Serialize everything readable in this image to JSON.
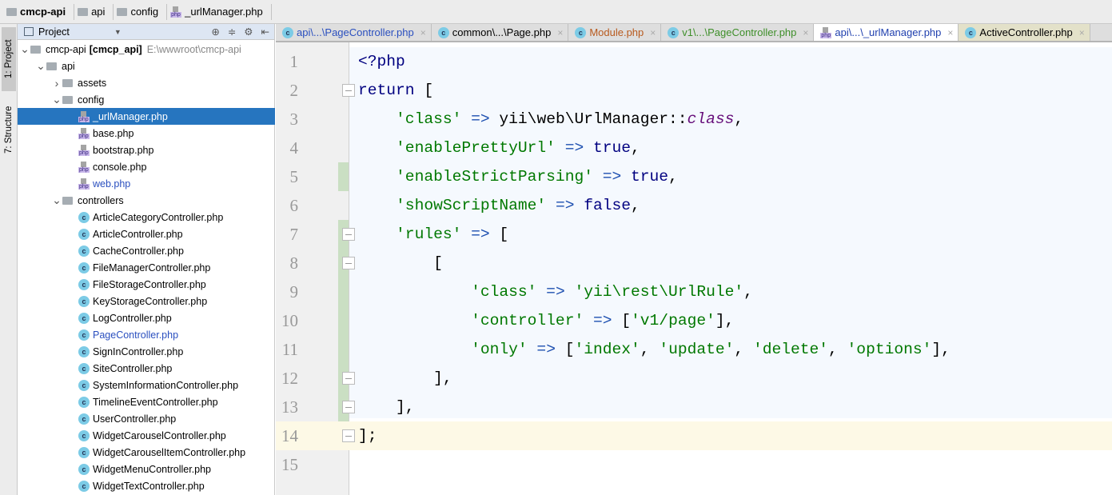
{
  "breadcrumb": [
    "cmcp-api",
    "api",
    "config",
    "_urlManager.php"
  ],
  "sidebar_tabs": [
    "1: Project",
    "7: Structure"
  ],
  "project": {
    "title": "Project",
    "tree": [
      {
        "label": "cmcp-api",
        "bold": "[cmcp_api]",
        "path": "E:\\wwwroot\\cmcp-api",
        "depth": 0,
        "kind": "folder",
        "exp": "v"
      },
      {
        "label": "api",
        "depth": 1,
        "kind": "folder",
        "exp": "v"
      },
      {
        "label": "assets",
        "depth": 2,
        "kind": "folder",
        "exp": ">"
      },
      {
        "label": "config",
        "depth": 2,
        "kind": "folder",
        "exp": "v"
      },
      {
        "label": "_urlManager.php",
        "depth": 3,
        "kind": "php",
        "selected": true
      },
      {
        "label": "base.php",
        "depth": 3,
        "kind": "php"
      },
      {
        "label": "bootstrap.php",
        "depth": 3,
        "kind": "php"
      },
      {
        "label": "console.php",
        "depth": 3,
        "kind": "php"
      },
      {
        "label": "web.php",
        "depth": 3,
        "kind": "php",
        "color": "#2a4fbf"
      },
      {
        "label": "controllers",
        "depth": 2,
        "kind": "folder",
        "exp": "v"
      },
      {
        "label": "ArticleCategoryController.php",
        "depth": 3,
        "kind": "class"
      },
      {
        "label": "ArticleController.php",
        "depth": 3,
        "kind": "class"
      },
      {
        "label": "CacheController.php",
        "depth": 3,
        "kind": "class"
      },
      {
        "label": "FileManagerController.php",
        "depth": 3,
        "kind": "class"
      },
      {
        "label": "FileStorageController.php",
        "depth": 3,
        "kind": "class"
      },
      {
        "label": "KeyStorageController.php",
        "depth": 3,
        "kind": "class"
      },
      {
        "label": "LogController.php",
        "depth": 3,
        "kind": "class"
      },
      {
        "label": "PageController.php",
        "depth": 3,
        "kind": "class",
        "color": "#2a4fbf"
      },
      {
        "label": "SignInController.php",
        "depth": 3,
        "kind": "class"
      },
      {
        "label": "SiteController.php",
        "depth": 3,
        "kind": "class"
      },
      {
        "label": "SystemInformationController.php",
        "depth": 3,
        "kind": "class"
      },
      {
        "label": "TimelineEventController.php",
        "depth": 3,
        "kind": "class"
      },
      {
        "label": "UserController.php",
        "depth": 3,
        "kind": "class"
      },
      {
        "label": "WidgetCarouselController.php",
        "depth": 3,
        "kind": "class"
      },
      {
        "label": "WidgetCarouselItemController.php",
        "depth": 3,
        "kind": "class"
      },
      {
        "label": "WidgetMenuController.php",
        "depth": 3,
        "kind": "class"
      },
      {
        "label": "WidgetTextController.php",
        "depth": 3,
        "kind": "class"
      }
    ]
  },
  "tabs": [
    {
      "label": "api\\...\\PageController.php",
      "kind": "class",
      "color": "#2a4fbf"
    },
    {
      "label": "common\\...\\Page.php",
      "kind": "class",
      "color": "#000000"
    },
    {
      "label": "Module.php",
      "kind": "class",
      "color": "#b85a1e"
    },
    {
      "label": "v1\\...\\PageController.php",
      "kind": "class",
      "color": "#3f8f2a"
    },
    {
      "label": "api\\...\\_urlManager.php",
      "kind": "php",
      "color": "#1f3fae",
      "active": true
    },
    {
      "label": "ActiveController.php",
      "kind": "class",
      "color": "#000000",
      "bg": "#e3e1c9"
    }
  ],
  "code": [
    [
      [
        "kw",
        "<?php"
      ]
    ],
    [
      [
        "kw",
        "return "
      ],
      [
        "pl",
        "["
      ]
    ],
    [
      [
        "pl",
        "    "
      ],
      [
        "str",
        "'class'"
      ],
      [
        "op",
        " => "
      ],
      [
        "pl",
        "yii\\web\\UrlManager::"
      ],
      [
        "it",
        "class"
      ],
      [
        "pl",
        ","
      ]
    ],
    [
      [
        "pl",
        "    "
      ],
      [
        "str",
        "'enablePrettyUrl'"
      ],
      [
        "op",
        " => "
      ],
      [
        "kw",
        "true"
      ],
      [
        "pl",
        ","
      ]
    ],
    [
      [
        "pl",
        "    "
      ],
      [
        "str",
        "'enableStrictParsing'"
      ],
      [
        "op",
        " => "
      ],
      [
        "kw",
        "true"
      ],
      [
        "pl",
        ","
      ]
    ],
    [
      [
        "pl",
        "    "
      ],
      [
        "str",
        "'showScriptName'"
      ],
      [
        "op",
        " => "
      ],
      [
        "kw",
        "false"
      ],
      [
        "pl",
        ","
      ]
    ],
    [
      [
        "pl",
        "    "
      ],
      [
        "str",
        "'rules'"
      ],
      [
        "op",
        " => "
      ],
      [
        "pl",
        "["
      ]
    ],
    [
      [
        "pl",
        "        ["
      ]
    ],
    [
      [
        "pl",
        "            "
      ],
      [
        "str",
        "'class'"
      ],
      [
        "op",
        " => "
      ],
      [
        "str",
        "'yii\\rest\\UrlRule'"
      ],
      [
        "pl",
        ","
      ]
    ],
    [
      [
        "pl",
        "            "
      ],
      [
        "str",
        "'controller'"
      ],
      [
        "op",
        " => "
      ],
      [
        "pl",
        "["
      ],
      [
        "str",
        "'v1/page'"
      ],
      [
        "pl",
        "],"
      ]
    ],
    [
      [
        "pl",
        "            "
      ],
      [
        "str",
        "'only'"
      ],
      [
        "op",
        " => "
      ],
      [
        "pl",
        "["
      ],
      [
        "str",
        "'index'"
      ],
      [
        "pl",
        ", "
      ],
      [
        "str",
        "'update'"
      ],
      [
        "pl",
        ", "
      ],
      [
        "str",
        "'delete'"
      ],
      [
        "pl",
        ", "
      ],
      [
        "str",
        "'options'"
      ],
      [
        "pl",
        "],"
      ]
    ],
    [
      [
        "pl",
        "        ],"
      ]
    ],
    [
      [
        "pl",
        "    ],"
      ]
    ],
    [
      [
        "pl",
        "];"
      ]
    ],
    []
  ],
  "current_line": 14,
  "changed_lines": [
    5,
    7,
    8,
    9,
    10,
    11,
    12,
    13
  ],
  "fold_lines": [
    2,
    7,
    8,
    12,
    13,
    14
  ]
}
